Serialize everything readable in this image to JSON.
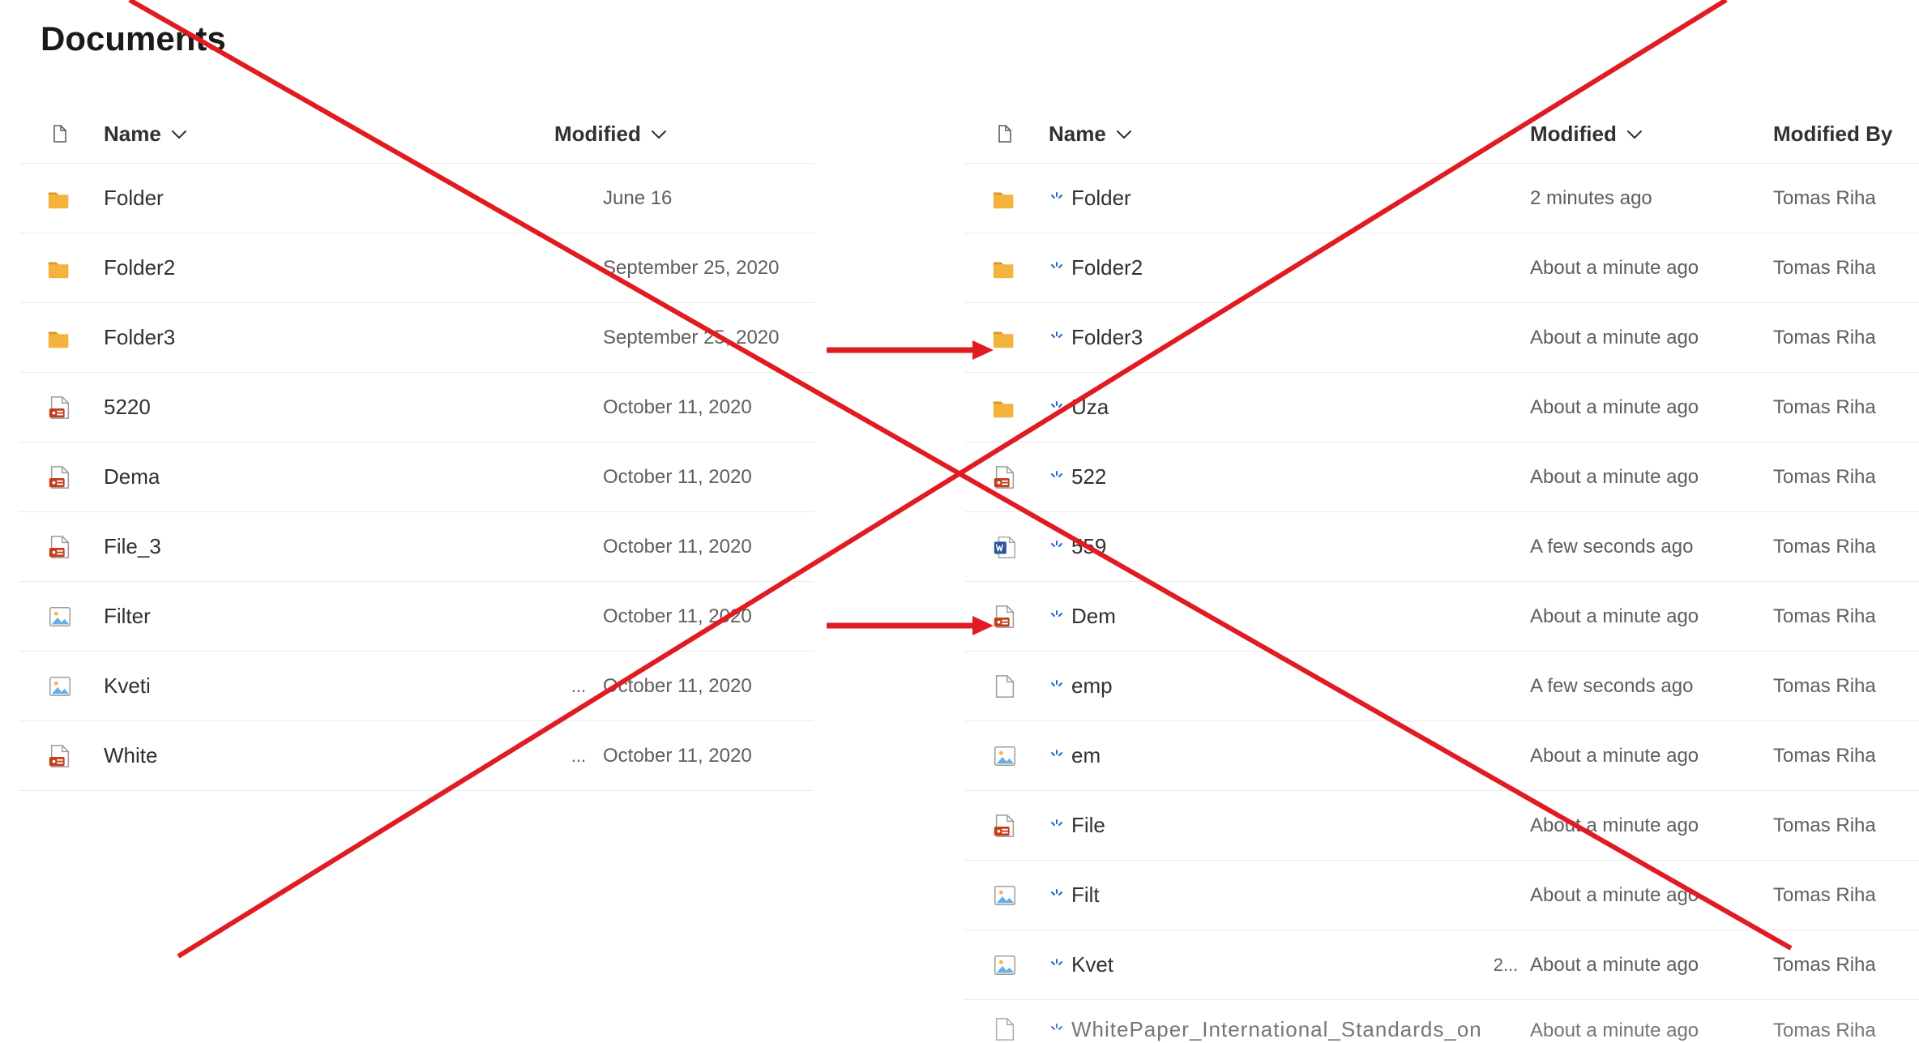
{
  "title": "Documents",
  "colors": {
    "red": "#e11b22",
    "folder": "#f3b33d",
    "folder_tab": "#d69a1e",
    "pdf": "#c43e1c",
    "word_blue": "#2b579a",
    "img_accent": "#69afe5",
    "grey": "#605e5c",
    "blue_accent": "#2266cc"
  },
  "columns": {
    "name": "Name",
    "modified": "Modified",
    "modified_by": "Modified By"
  },
  "left": {
    "rows": [
      {
        "icon": "folder",
        "name": "Folder",
        "name_full": true,
        "overflow": "",
        "modified": "June 16"
      },
      {
        "icon": "folder",
        "name": "Folder2",
        "name_full": true,
        "overflow": "",
        "modified": "September 25, 2020"
      },
      {
        "icon": "folder",
        "name": "Folder3",
        "name_full": true,
        "overflow": "",
        "modified": "September 25, 2020"
      },
      {
        "icon": "pdf",
        "name": "5220",
        "name_full": false,
        "overflow": "",
        "modified": "October 11, 2020"
      },
      {
        "icon": "pdf",
        "name": "Dema",
        "name_full": false,
        "overflow": "",
        "modified": "October 11, 2020"
      },
      {
        "icon": "pdf",
        "name": "File_3",
        "name_full": false,
        "overflow": "",
        "modified": "October 11, 2020"
      },
      {
        "icon": "image",
        "name": "Filter",
        "name_full": false,
        "overflow": "",
        "modified": "October 11, 2020"
      },
      {
        "icon": "image",
        "name": "Kveti",
        "name_full": false,
        "overflow": "...",
        "modified": "October 11, 2020"
      },
      {
        "icon": "pdf",
        "name": "White",
        "name_full": false,
        "overflow": "...",
        "modified": "October 11, 2020"
      }
    ]
  },
  "right": {
    "rows": [
      {
        "icon": "folder",
        "loading": true,
        "name": "Folder",
        "name_full": true,
        "overflow": "",
        "modified": "2 minutes ago",
        "by": "Tomas Riha"
      },
      {
        "icon": "folder",
        "loading": true,
        "name": "Folder2",
        "name_full": true,
        "overflow": "",
        "modified": "About a minute ago",
        "by": "Tomas Riha"
      },
      {
        "icon": "folder",
        "loading": true,
        "name": "Folder3",
        "name_full": true,
        "overflow": "",
        "modified": "About a minute ago",
        "by": "Tomas Riha"
      },
      {
        "icon": "folder",
        "loading": true,
        "name": "Uza",
        "name_full": false,
        "overflow": "",
        "modified": "About a minute ago",
        "by": "Tomas Riha"
      },
      {
        "icon": "pdf",
        "loading": true,
        "name": "522",
        "name_full": false,
        "overflow": "",
        "modified": "About a minute ago",
        "by": "Tomas Riha"
      },
      {
        "icon": "word",
        "loading": true,
        "name": "559",
        "name_full": false,
        "overflow": "",
        "modified": "A few seconds ago",
        "by": "Tomas Riha"
      },
      {
        "icon": "pdf",
        "loading": true,
        "name": "Dem",
        "name_full": false,
        "overflow": "",
        "modified": "About a minute ago",
        "by": "Tomas Riha"
      },
      {
        "icon": "file",
        "loading": true,
        "name": "emp",
        "name_full": false,
        "overflow": "",
        "modified": "A few seconds ago",
        "by": "Tomas Riha"
      },
      {
        "icon": "image",
        "loading": true,
        "name": "em",
        "name_full": false,
        "overflow": "",
        "modified": "About a minute ago",
        "by": "Tomas Riha"
      },
      {
        "icon": "pdf",
        "loading": true,
        "name": "File",
        "name_full": false,
        "overflow": "",
        "modified": "About a minute ago",
        "by": "Tomas Riha"
      },
      {
        "icon": "image",
        "loading": true,
        "name": "Filt",
        "name_full": false,
        "overflow": "",
        "modified": "About a minute ago",
        "by": "Tomas Riha"
      },
      {
        "icon": "image",
        "loading": true,
        "name": "Kvet",
        "name_full": false,
        "overflow": "2...",
        "modified": "About a minute ago",
        "by": "Tomas Riha"
      },
      {
        "icon": "file",
        "loading": true,
        "name": "WhitePaper_International_Standards_on",
        "name_full": false,
        "overflow": "",
        "modified": "About a minute ago",
        "by": "Tomas Riha"
      }
    ]
  }
}
